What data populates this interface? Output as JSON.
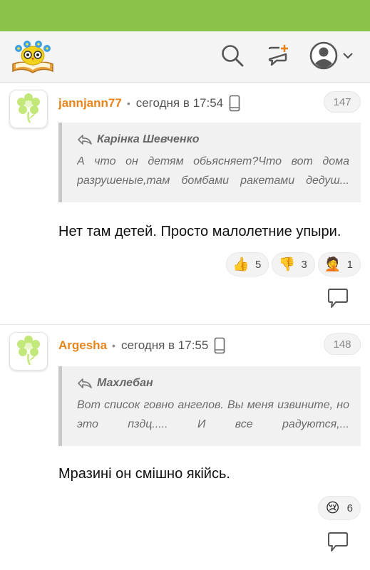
{
  "header": {
    "logo": "book-with-owl-logo",
    "icons": {
      "search": "search-icon",
      "new_post": "new-post-icon",
      "profile": "user-avatar-icon",
      "profile_menu": "chevron-down-icon"
    }
  },
  "colors": {
    "top_strip": "#8bc34a",
    "username": "#e8841b",
    "header_bg": "#f4f4f4"
  },
  "comments": [
    {
      "username": "jannjann77",
      "separator": "•",
      "time": "сегодня в 17:54",
      "device_icon": "phone-icon",
      "number": "147",
      "avatar_icon": "green-flower-icon",
      "quote": {
        "author": "Карінка Шевченко",
        "text": "А что он детям обьясняет?Что вот дома разрушеные,там бомбами ракетами дедуш..."
      },
      "text": "Нет там детей. Просто малолетние упыри.",
      "reactions": [
        {
          "icon": "thumbs-up-emoji",
          "emoji": "👍",
          "count": "5"
        },
        {
          "icon": "thumbs-down-emoji",
          "emoji": "👎",
          "count": "3"
        },
        {
          "icon": "facepalm-emoji",
          "emoji": "🤦",
          "count": "1"
        }
      ],
      "reply_icon": "comment-reply-icon"
    },
    {
      "username": "Argesha",
      "separator": "•",
      "time": "сегодня в 17:55",
      "device_icon": "phone-icon",
      "number": "148",
      "avatar_icon": "green-flower-icon",
      "quote": {
        "author": "Махлебан",
        "text": "Вот список говно ангелов. Вы меня извините, но это пздц..... И все радуются,..."
      },
      "text": "Мразині он смішно якійсь.",
      "reactions": [
        {
          "icon": "crying-face-emoji",
          "emoji": "😢",
          "count": "6"
        }
      ],
      "reply_icon": "comment-reply-icon"
    }
  ]
}
